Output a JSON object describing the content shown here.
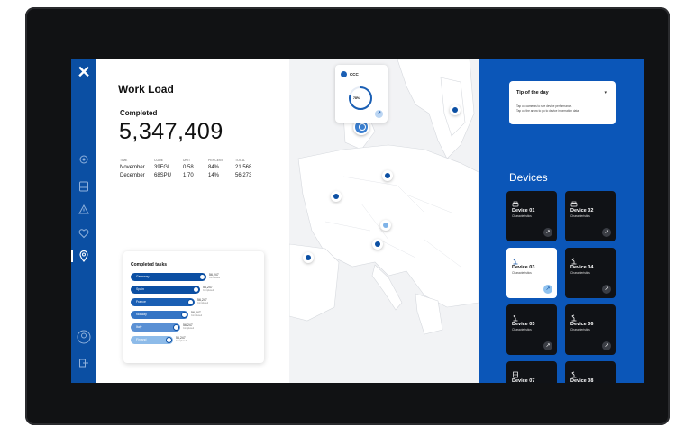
{
  "sidebar": {
    "logo": "✕",
    "items": [
      {
        "name": "settings-icon"
      },
      {
        "name": "storage-icon"
      },
      {
        "name": "warning-icon"
      },
      {
        "name": "heart-icon"
      },
      {
        "name": "location-icon",
        "active": true
      }
    ],
    "bottom": [
      {
        "name": "user-icon"
      },
      {
        "name": "logout-icon"
      }
    ]
  },
  "workload": {
    "title": "Work Load",
    "completed_label": "Completed",
    "completed_value": "5,347,409",
    "headers": [
      "TIME",
      "CODE",
      "UNIT",
      "PERCENT",
      "TOTAL"
    ],
    "rows": [
      [
        "November",
        "39FGI",
        "0.58",
        "84%",
        "21,568"
      ],
      [
        "December",
        "68SPU",
        "1.70",
        "14%",
        "56,273"
      ]
    ]
  },
  "tasks": {
    "title": "Completed tasks",
    "items": [
      {
        "country": "Germany",
        "value": "56,247",
        "sub": "Completed",
        "color": "#0b4fa3",
        "fraction": 1.0
      },
      {
        "country": "Spain",
        "value": "56,247",
        "sub": "Completed",
        "color": "#0b4fa3",
        "fraction": 0.92
      },
      {
        "country": "France",
        "value": "56,247",
        "sub": "Completed",
        "color": "#1a5fb4",
        "fraction": 0.84
      },
      {
        "country": "Norway",
        "value": "56,247",
        "sub": "Completed",
        "color": "#3474c4",
        "fraction": 0.76
      },
      {
        "country": "Italy",
        "value": "56,247",
        "sub": "Completed",
        "color": "#5a90d4",
        "fraction": 0.66
      },
      {
        "country": "Finland",
        "value": "56,247",
        "sub": "Completed",
        "color": "#8dbbe9",
        "fraction": 0.56
      }
    ]
  },
  "map": {
    "card_name": "CCC",
    "card_percent": "78%",
    "card_progress": 0.78
  },
  "tip": {
    "title": "Tip of the day",
    "text_1": "Tap on cameras to see device performance.",
    "text_2": "Tap on the arrow to go to device information data."
  },
  "devices": {
    "title": "Devices",
    "items": [
      {
        "name": "Device 01",
        "sub": "Characteristics",
        "icon": "printer-icon"
      },
      {
        "name": "Device 02",
        "sub": "Characteristics",
        "icon": "printer-icon"
      },
      {
        "name": "Device 03",
        "sub": "Characteristics",
        "icon": "robot-arm-icon",
        "selected": true
      },
      {
        "name": "Device 04",
        "sub": "Characteristics",
        "icon": "robot-arm-icon"
      },
      {
        "name": "Device 05",
        "sub": "Characteristics",
        "icon": "robot-arm-icon"
      },
      {
        "name": "Device 06",
        "sub": "Characteristics",
        "icon": "robot-arm-icon"
      },
      {
        "name": "Device 07",
        "sub": "",
        "icon": "server-icon"
      },
      {
        "name": "Device 08",
        "sub": "",
        "icon": "robot-arm-icon"
      }
    ]
  }
}
